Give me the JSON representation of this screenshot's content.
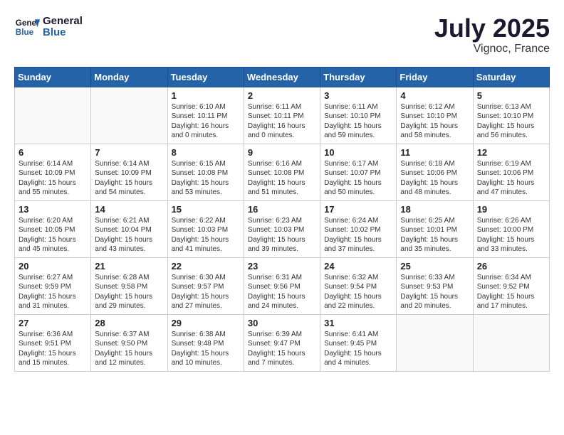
{
  "logo": {
    "line1": "General",
    "line2": "Blue"
  },
  "title": "July 2025",
  "location": "Vignoc, France",
  "days_of_week": [
    "Sunday",
    "Monday",
    "Tuesday",
    "Wednesday",
    "Thursday",
    "Friday",
    "Saturday"
  ],
  "weeks": [
    [
      {
        "day": "",
        "content": ""
      },
      {
        "day": "",
        "content": ""
      },
      {
        "day": "1",
        "content": "Sunrise: 6:10 AM\nSunset: 10:11 PM\nDaylight: 16 hours\nand 0 minutes."
      },
      {
        "day": "2",
        "content": "Sunrise: 6:11 AM\nSunset: 10:11 PM\nDaylight: 16 hours\nand 0 minutes."
      },
      {
        "day": "3",
        "content": "Sunrise: 6:11 AM\nSunset: 10:10 PM\nDaylight: 15 hours\nand 59 minutes."
      },
      {
        "day": "4",
        "content": "Sunrise: 6:12 AM\nSunset: 10:10 PM\nDaylight: 15 hours\nand 58 minutes."
      },
      {
        "day": "5",
        "content": "Sunrise: 6:13 AM\nSunset: 10:10 PM\nDaylight: 15 hours\nand 56 minutes."
      }
    ],
    [
      {
        "day": "6",
        "content": "Sunrise: 6:14 AM\nSunset: 10:09 PM\nDaylight: 15 hours\nand 55 minutes."
      },
      {
        "day": "7",
        "content": "Sunrise: 6:14 AM\nSunset: 10:09 PM\nDaylight: 15 hours\nand 54 minutes."
      },
      {
        "day": "8",
        "content": "Sunrise: 6:15 AM\nSunset: 10:08 PM\nDaylight: 15 hours\nand 53 minutes."
      },
      {
        "day": "9",
        "content": "Sunrise: 6:16 AM\nSunset: 10:08 PM\nDaylight: 15 hours\nand 51 minutes."
      },
      {
        "day": "10",
        "content": "Sunrise: 6:17 AM\nSunset: 10:07 PM\nDaylight: 15 hours\nand 50 minutes."
      },
      {
        "day": "11",
        "content": "Sunrise: 6:18 AM\nSunset: 10:06 PM\nDaylight: 15 hours\nand 48 minutes."
      },
      {
        "day": "12",
        "content": "Sunrise: 6:19 AM\nSunset: 10:06 PM\nDaylight: 15 hours\nand 47 minutes."
      }
    ],
    [
      {
        "day": "13",
        "content": "Sunrise: 6:20 AM\nSunset: 10:05 PM\nDaylight: 15 hours\nand 45 minutes."
      },
      {
        "day": "14",
        "content": "Sunrise: 6:21 AM\nSunset: 10:04 PM\nDaylight: 15 hours\nand 43 minutes."
      },
      {
        "day": "15",
        "content": "Sunrise: 6:22 AM\nSunset: 10:03 PM\nDaylight: 15 hours\nand 41 minutes."
      },
      {
        "day": "16",
        "content": "Sunrise: 6:23 AM\nSunset: 10:03 PM\nDaylight: 15 hours\nand 39 minutes."
      },
      {
        "day": "17",
        "content": "Sunrise: 6:24 AM\nSunset: 10:02 PM\nDaylight: 15 hours\nand 37 minutes."
      },
      {
        "day": "18",
        "content": "Sunrise: 6:25 AM\nSunset: 10:01 PM\nDaylight: 15 hours\nand 35 minutes."
      },
      {
        "day": "19",
        "content": "Sunrise: 6:26 AM\nSunset: 10:00 PM\nDaylight: 15 hours\nand 33 minutes."
      }
    ],
    [
      {
        "day": "20",
        "content": "Sunrise: 6:27 AM\nSunset: 9:59 PM\nDaylight: 15 hours\nand 31 minutes."
      },
      {
        "day": "21",
        "content": "Sunrise: 6:28 AM\nSunset: 9:58 PM\nDaylight: 15 hours\nand 29 minutes."
      },
      {
        "day": "22",
        "content": "Sunrise: 6:30 AM\nSunset: 9:57 PM\nDaylight: 15 hours\nand 27 minutes."
      },
      {
        "day": "23",
        "content": "Sunrise: 6:31 AM\nSunset: 9:56 PM\nDaylight: 15 hours\nand 24 minutes."
      },
      {
        "day": "24",
        "content": "Sunrise: 6:32 AM\nSunset: 9:54 PM\nDaylight: 15 hours\nand 22 minutes."
      },
      {
        "day": "25",
        "content": "Sunrise: 6:33 AM\nSunset: 9:53 PM\nDaylight: 15 hours\nand 20 minutes."
      },
      {
        "day": "26",
        "content": "Sunrise: 6:34 AM\nSunset: 9:52 PM\nDaylight: 15 hours\nand 17 minutes."
      }
    ],
    [
      {
        "day": "27",
        "content": "Sunrise: 6:36 AM\nSunset: 9:51 PM\nDaylight: 15 hours\nand 15 minutes."
      },
      {
        "day": "28",
        "content": "Sunrise: 6:37 AM\nSunset: 9:50 PM\nDaylight: 15 hours\nand 12 minutes."
      },
      {
        "day": "29",
        "content": "Sunrise: 6:38 AM\nSunset: 9:48 PM\nDaylight: 15 hours\nand 10 minutes."
      },
      {
        "day": "30",
        "content": "Sunrise: 6:39 AM\nSunset: 9:47 PM\nDaylight: 15 hours\nand 7 minutes."
      },
      {
        "day": "31",
        "content": "Sunrise: 6:41 AM\nSunset: 9:45 PM\nDaylight: 15 hours\nand 4 minutes."
      },
      {
        "day": "",
        "content": ""
      },
      {
        "day": "",
        "content": ""
      }
    ]
  ]
}
